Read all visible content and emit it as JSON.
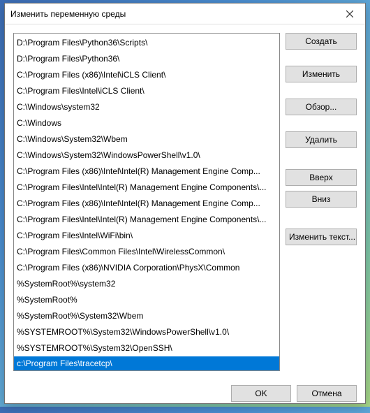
{
  "window": {
    "title": "Изменить переменную среды"
  },
  "listbox": {
    "items": [
      "D:\\Program Files\\Python36\\Scripts\\",
      "D:\\Program Files\\Python36\\",
      "C:\\Program Files (x86)\\Intel\\iCLS Client\\",
      "C:\\Program Files\\Intel\\iCLS Client\\",
      "C:\\Windows\\system32",
      "C:\\Windows",
      "C:\\Windows\\System32\\Wbem",
      "C:\\Windows\\System32\\WindowsPowerShell\\v1.0\\",
      "C:\\Program Files (x86)\\Intel\\Intel(R) Management Engine Comp...",
      "C:\\Program Files\\Intel\\Intel(R) Management Engine Components\\...",
      "C:\\Program Files (x86)\\Intel\\Intel(R) Management Engine Comp...",
      "C:\\Program Files\\Intel\\Intel(R) Management Engine Components\\...",
      "C:\\Program Files\\Intel\\WiFi\\bin\\",
      "C:\\Program Files\\Common Files\\Intel\\WirelessCommon\\",
      "C:\\Program Files (x86)\\NVIDIA Corporation\\PhysX\\Common",
      "%SystemRoot%\\system32",
      "%SystemRoot%",
      "%SystemRoot%\\System32\\Wbem",
      "%SYSTEMROOT%\\System32\\WindowsPowerShell\\v1.0\\",
      "%SYSTEMROOT%\\System32\\OpenSSH\\"
    ],
    "editing_value": "c:\\Program Files\\tracetcp\\"
  },
  "buttons": {
    "new": "Создать",
    "edit": "Изменить",
    "browse": "Обзор...",
    "delete": "Удалить",
    "up": "Вверх",
    "down": "Вниз",
    "edit_text": "Изменить текст..."
  },
  "footer": {
    "ok": "OK",
    "cancel": "Отмена"
  }
}
